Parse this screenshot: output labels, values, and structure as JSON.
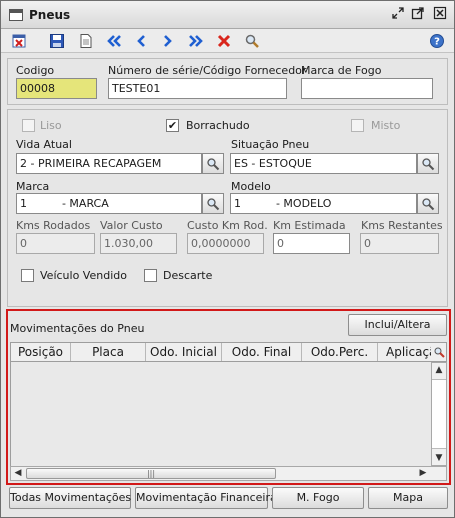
{
  "window": {
    "title": "Pneus"
  },
  "form": {
    "codigo_label": "Codigo",
    "codigo_value": "00008",
    "serie_label": "Número de série/Código Fornecedor",
    "serie_value": "TESTE01",
    "marca_fogo_label": "Marca de Fogo",
    "marca_fogo_value": "",
    "liso_label": "Liso",
    "liso_checked": false,
    "borrachudo_label": "Borrachudo",
    "borrachudo_checked": true,
    "misto_label": "Misto",
    "misto_checked": false,
    "vida_atual_label": "Vida Atual",
    "vida_atual_value": "2  - PRIMEIRA RECAPAGEM",
    "situacao_label": "Situação Pneu",
    "situacao_value": "ES - ESTOQUE",
    "marca_label": "Marca",
    "marca_value": "1          - MARCA",
    "modelo_label": "Modelo",
    "modelo_value": "1          - MODELO",
    "kms_rodados_label": "Kms Rodados",
    "kms_rodados_value": "0",
    "valor_custo_label": "Valor Custo",
    "valor_custo_value": "1.030,00",
    "custo_km_label": "Custo Km Rod.",
    "custo_km_value": "0,0000000",
    "km_estimada_label": "Km Estimada",
    "km_estimada_value": "0",
    "kms_restantes_label": "Kms Restantes",
    "kms_restantes_value": "0",
    "veiculo_vendido_label": "Veículo Vendido",
    "descarte_label": "Descarte"
  },
  "movimentacoes": {
    "title": "Movimentações do Pneu",
    "inclui_button": "Inclui/Altera",
    "columns": [
      "Posição",
      "Placa",
      "Odo. Inicial",
      "Odo. Final",
      "Odo.Perc.",
      "Aplicação"
    ],
    "rows": []
  },
  "footer": {
    "todas_button": "Todas Movimentações",
    "financeira_button": "Movimentação Financeira",
    "mfogo_button": "M. Fogo",
    "mapa_button": "Mapa"
  },
  "icons": {
    "window": "window-icon",
    "toolbar": [
      "delete-record-icon",
      "save-icon",
      "new-document-icon",
      "first-icon",
      "previous-icon",
      "next-icon",
      "last-icon",
      "cancel-icon",
      "search-icon",
      "help-icon"
    ]
  },
  "colors": {
    "highlight_frame": "#d21919",
    "required_field": "#e5e57a",
    "nav_arrows": "#1f5fd1"
  }
}
